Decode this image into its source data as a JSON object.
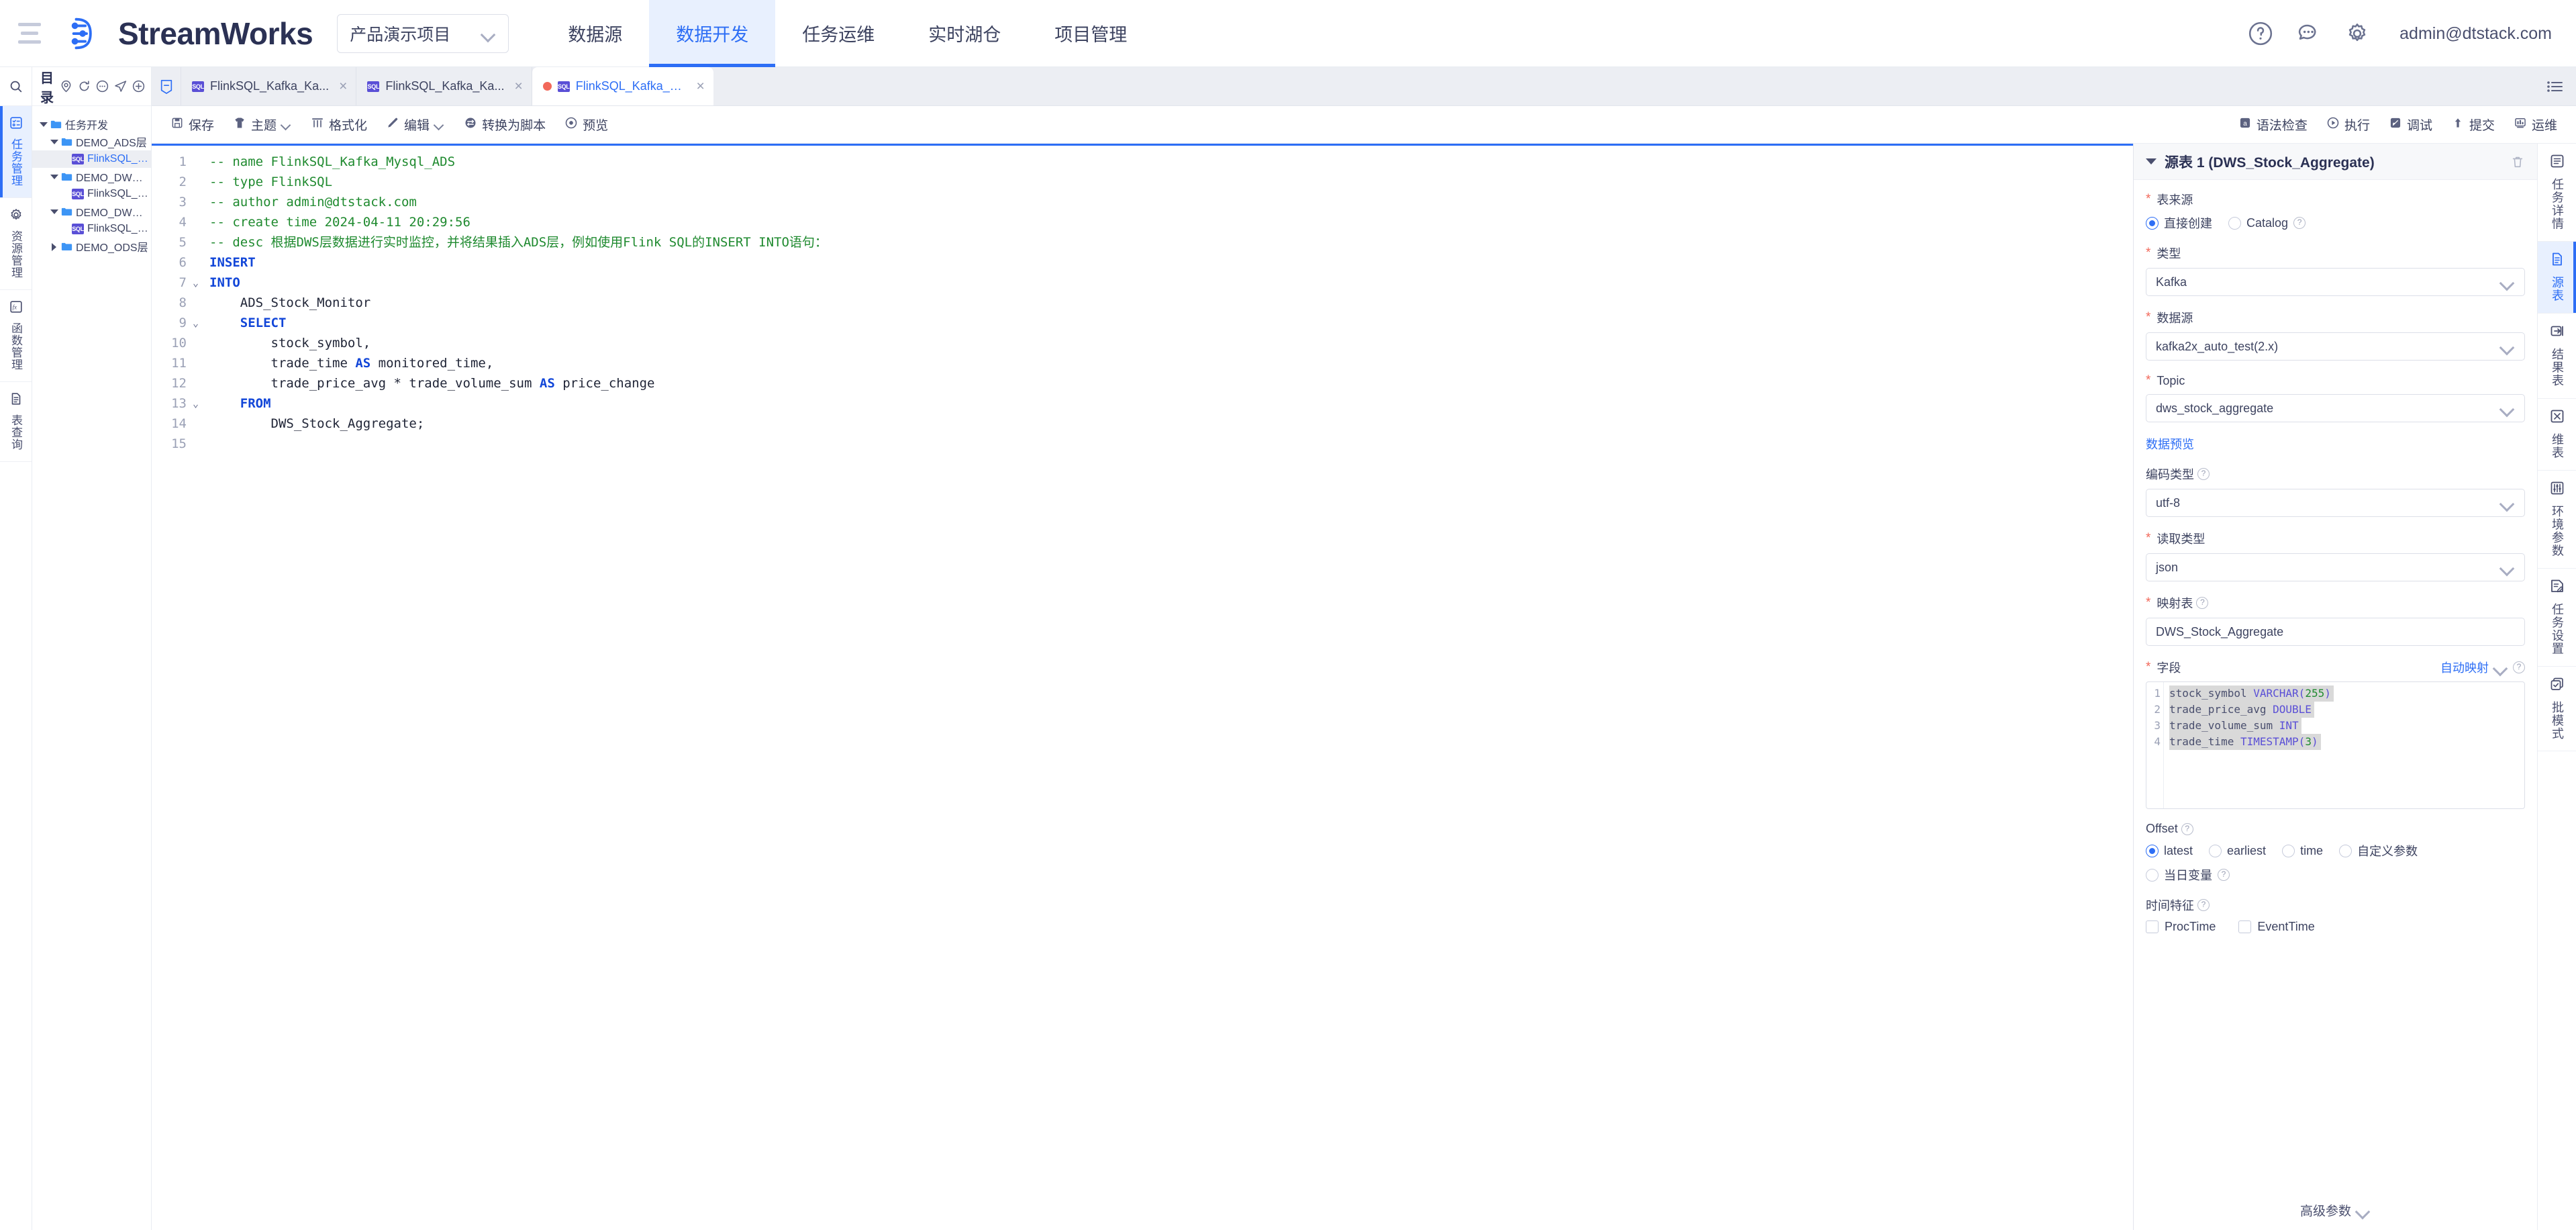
{
  "topbar": {
    "brand": "StreamWorks",
    "project": "产品演示项目",
    "nav": [
      {
        "label": "数据源",
        "active": false
      },
      {
        "label": "数据开发",
        "active": true
      },
      {
        "label": "任务运维",
        "active": false
      },
      {
        "label": "实时湖仓",
        "active": false
      },
      {
        "label": "项目管理",
        "active": false
      }
    ],
    "icons": [
      "help-icon",
      "message-icon",
      "gear-icon"
    ],
    "user": "admin@dtstack.com"
  },
  "leftrail": {
    "search": "search-icon",
    "items": [
      {
        "label": "任务管理",
        "icon": "task-list-icon",
        "active": true
      },
      {
        "label": "资源管理",
        "icon": "gear-icon",
        "active": false
      },
      {
        "label": "函数管理",
        "icon": "function-icon",
        "active": false
      },
      {
        "label": "表查询",
        "icon": "document-icon",
        "active": false
      }
    ]
  },
  "directory": {
    "title": "目录",
    "header_icons": [
      "locate-icon",
      "refresh-icon",
      "more-icon",
      "publish-icon",
      "add-icon"
    ],
    "tree": [
      {
        "label": "任务开发",
        "type": "folder",
        "indent": 0,
        "state": "open",
        "selected": false
      },
      {
        "label": "DEMO_ADS层",
        "type": "folder",
        "indent": 1,
        "state": "open",
        "selected": false
      },
      {
        "label": "FlinkSQL_Kafka_Mysql_...",
        "type": "sql",
        "indent": 2,
        "state": "leaf",
        "selected": true
      },
      {
        "label": "DEMO_DWS层",
        "type": "folder",
        "indent": 1,
        "state": "open",
        "selected": false
      },
      {
        "label": "FlinkSQL_Kafka_Kafka_...",
        "type": "sql",
        "indent": 2,
        "state": "leaf",
        "selected": false
      },
      {
        "label": "DEMO_DWD层",
        "type": "folder",
        "indent": 1,
        "state": "open",
        "selected": false
      },
      {
        "label": "FlinkSQL_Kafka_Kafka_...",
        "type": "sql",
        "indent": 2,
        "state": "leaf",
        "selected": false
      },
      {
        "label": "DEMO_ODS层",
        "type": "folder",
        "indent": 1,
        "state": "closed",
        "selected": false
      }
    ]
  },
  "tabs": {
    "home_icon": "home-icon",
    "items": [
      {
        "label": "FlinkSQL_Kafka_Ka...",
        "active": false,
        "modified": false
      },
      {
        "label": "FlinkSQL_Kafka_Ka...",
        "active": false,
        "modified": false
      },
      {
        "label": "FlinkSQL_Kafka_M...",
        "active": true,
        "modified": true
      }
    ],
    "list_icon": "tab-list-icon"
  },
  "toolbar": {
    "left": [
      {
        "label": "保存",
        "icon": "save-icon",
        "caret": false
      },
      {
        "label": "主题",
        "icon": "theme-icon",
        "caret": true
      },
      {
        "label": "格式化",
        "icon": "format-icon",
        "caret": false
      },
      {
        "label": "编辑",
        "icon": "edit-icon",
        "caret": true
      },
      {
        "label": "转换为脚本",
        "icon": "convert-icon",
        "caret": false
      },
      {
        "label": "预览",
        "icon": "preview-icon",
        "caret": false
      }
    ],
    "right": [
      {
        "label": "语法检查",
        "icon": "syntax-check-icon"
      },
      {
        "label": "执行",
        "icon": "run-icon"
      },
      {
        "label": "调试",
        "icon": "debug-icon"
      },
      {
        "label": "提交",
        "icon": "submit-icon"
      },
      {
        "label": "运维",
        "icon": "ops-icon"
      }
    ]
  },
  "editor": {
    "lines": [
      {
        "n": 1,
        "fold": "",
        "segments": [
          {
            "t": "-- name FlinkSQL_Kafka_Mysql_ADS",
            "c": "cmt"
          }
        ]
      },
      {
        "n": 2,
        "fold": "",
        "segments": [
          {
            "t": "-- type FlinkSQL",
            "c": "cmt"
          }
        ]
      },
      {
        "n": 3,
        "fold": "",
        "segments": [
          {
            "t": "-- author admin@dtstack.com",
            "c": "cmt"
          }
        ]
      },
      {
        "n": 4,
        "fold": "",
        "segments": [
          {
            "t": "-- create time 2024-04-11 20:29:56",
            "c": "cmt"
          }
        ]
      },
      {
        "n": 5,
        "fold": "",
        "segments": [
          {
            "t": "-- desc 根据DWS层数据进行实时监控，并将结果插入ADS层，例如使用Flink SQL的INSERT INTO语句：",
            "c": "cmt"
          }
        ]
      },
      {
        "n": 6,
        "fold": "",
        "segments": [
          {
            "t": "INSERT",
            "c": "kw"
          }
        ]
      },
      {
        "n": 7,
        "fold": "v",
        "segments": [
          {
            "t": "INTO",
            "c": "kw"
          }
        ]
      },
      {
        "n": 8,
        "fold": "",
        "segments": [
          {
            "t": "    ADS_Stock_Monitor",
            "c": "idt"
          }
        ]
      },
      {
        "n": 9,
        "fold": "v",
        "segments": [
          {
            "t": "    ",
            "c": "idt"
          },
          {
            "t": "SELECT",
            "c": "kw"
          }
        ]
      },
      {
        "n": 10,
        "fold": "",
        "segments": [
          {
            "t": "        stock_symbol,",
            "c": "idt"
          }
        ]
      },
      {
        "n": 11,
        "fold": "",
        "segments": [
          {
            "t": "        trade_time ",
            "c": "idt"
          },
          {
            "t": "AS",
            "c": "kw"
          },
          {
            "t": " monitored_time,",
            "c": "idt"
          }
        ]
      },
      {
        "n": 12,
        "fold": "",
        "segments": [
          {
            "t": "        trade_price_avg * trade_volume_sum ",
            "c": "idt"
          },
          {
            "t": "AS",
            "c": "kw"
          },
          {
            "t": " price_change",
            "c": "idt"
          }
        ]
      },
      {
        "n": 13,
        "fold": "v",
        "segments": [
          {
            "t": "    ",
            "c": "idt"
          },
          {
            "t": "FROM",
            "c": "kw"
          }
        ]
      },
      {
        "n": 14,
        "fold": "",
        "segments": [
          {
            "t": "        DWS_Stock_Aggregate;",
            "c": "idt"
          }
        ]
      },
      {
        "n": 15,
        "fold": "",
        "segments": [
          {
            "t": "",
            "c": "idt"
          }
        ]
      }
    ]
  },
  "config": {
    "header_title": "源表 1 (DWS_Stock_Aggregate)",
    "delete_icon": "trash-icon",
    "table_source": {
      "label": "表来源",
      "required": true,
      "options": [
        {
          "label": "直接创建",
          "selected": true,
          "help": false
        },
        {
          "label": "Catalog",
          "selected": false,
          "help": true
        }
      ]
    },
    "type": {
      "label": "类型",
      "required": true,
      "value": "Kafka"
    },
    "datasource": {
      "label": "数据源",
      "required": true,
      "value": "kafka2x_auto_test(2.x)"
    },
    "topic": {
      "label": "Topic",
      "required": true,
      "value": "dws_stock_aggregate"
    },
    "preview_link": "数据预览",
    "encoding": {
      "label": "编码类型",
      "required": false,
      "help": true,
      "value": "utf-8"
    },
    "read_type": {
      "label": "读取类型",
      "required": true,
      "value": "json"
    },
    "mapping_table": {
      "label": "映射表",
      "required": true,
      "help": true,
      "value": "DWS_Stock_Aggregate"
    },
    "fields": {
      "label": "字段",
      "required": true,
      "automap_label": "自动映射",
      "rows": [
        {
          "n": 1,
          "name": "stock_symbol",
          "type": "VARCHAR",
          "arg": "(255)",
          "highlight": true
        },
        {
          "n": 2,
          "name": "trade_price_avg",
          "type": "DOUBLE",
          "arg": "",
          "highlight": true
        },
        {
          "n": 3,
          "name": "trade_volume_sum",
          "type": "INT",
          "arg": "",
          "highlight": true
        },
        {
          "n": 4,
          "name": "trade_time",
          "type": "TIMESTAMP",
          "arg": "(3)",
          "highlight": true
        }
      ]
    },
    "offset": {
      "label": "Offset",
      "help": true,
      "options": [
        {
          "label": "latest",
          "selected": true,
          "help": false
        },
        {
          "label": "earliest",
          "selected": false,
          "help": false
        },
        {
          "label": "time",
          "selected": false,
          "help": false
        },
        {
          "label": "自定义参数",
          "selected": false,
          "help": false
        },
        {
          "label": "当日变量",
          "selected": false,
          "help": true
        }
      ]
    },
    "time_feature": {
      "label": "时间特征",
      "help": true,
      "options": [
        {
          "label": "ProcTime",
          "checked": false
        },
        {
          "label": "EventTime",
          "checked": false
        }
      ]
    },
    "advanced": "高级参数"
  },
  "rightrail": {
    "items": [
      {
        "label": "任务详情",
        "icon": "task-detail-icon",
        "active": false
      },
      {
        "label": "源表",
        "icon": "source-table-icon",
        "active": true
      },
      {
        "label": "结果表",
        "icon": "result-table-icon",
        "active": false
      },
      {
        "label": "维表",
        "icon": "dim-table-icon",
        "active": false
      },
      {
        "label": "环境参数",
        "icon": "env-params-icon",
        "active": false
      },
      {
        "label": "任务设置",
        "icon": "task-settings-icon",
        "active": false
      },
      {
        "label": "批模式",
        "icon": "batch-mode-icon",
        "active": false
      }
    ]
  },
  "colors": {
    "accent": "#2d6ef5",
    "accent_bg": "#e8f0fe",
    "text": "#3d4360",
    "required": "#f2685a",
    "sql_badge": "#5a4fd6",
    "comment": "#1f8a2f",
    "keyword": "#1246d8"
  }
}
